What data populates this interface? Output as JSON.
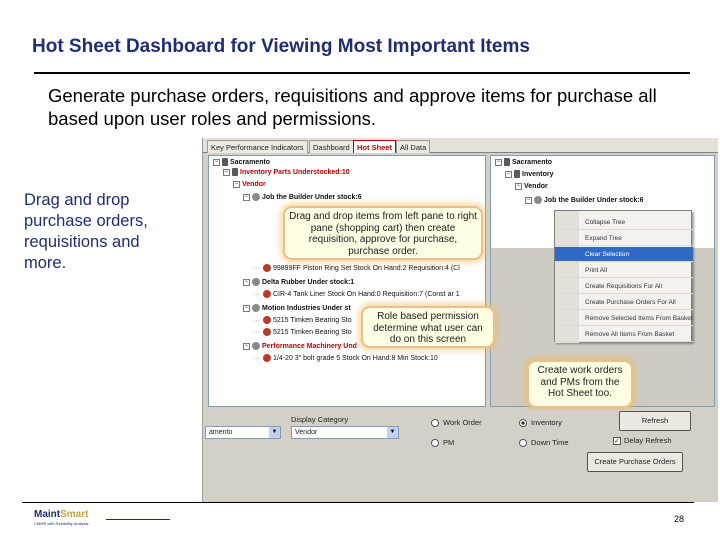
{
  "slide": {
    "title": "Hot Sheet Dashboard for Viewing Most Important Items",
    "subtitle": "Generate purchase orders, requisitions and approve items for purchase all based upon user roles and permissions.",
    "side_text": "Drag and drop purchase orders, requisitions and more.",
    "page_number": "28",
    "logo_main": "Maint",
    "logo_accent": "Smart",
    "logo_tagline": "CMMS with Reliability Analysis"
  },
  "app": {
    "tabs": [
      "Key Performance Indicators",
      "Dashboard",
      "Hot Sheet",
      "All Data"
    ],
    "active_tab": "Hot Sheet",
    "left_tree": [
      {
        "text": "Sacramento",
        "style": "bold",
        "indent": 0,
        "icon": "folder"
      },
      {
        "text": "Inventory Parts Understocked:10",
        "style": "red",
        "indent": 1,
        "icon": "folder"
      },
      {
        "text": "Vendor",
        "style": "red",
        "indent": 2,
        "icon": "none"
      },
      {
        "text": "Job the Builder Under stock:6",
        "style": "bold",
        "indent": 3,
        "icon": "cancel"
      },
      {
        "text": "99899FF Piston Ring Set Stock On Hand:2 Requisition:4 (Cl",
        "style": "normal",
        "indent": 4,
        "icon": "gear"
      },
      {
        "text": "Delta Rubber Under stock:1",
        "style": "bold",
        "indent": 3,
        "icon": "cancel"
      },
      {
        "text": "CIR-4 Tank Liner Stock On Hand:0 Requisition:7 (Const ar 1",
        "style": "normal",
        "indent": 4,
        "icon": "gear"
      },
      {
        "text": "Motion Industries Under st",
        "style": "bold",
        "indent": 3,
        "icon": "cancel"
      },
      {
        "text": "5215 Timken Bearing Sto",
        "style": "normal",
        "indent": 4,
        "icon": "gear"
      },
      {
        "text": "5215 Timken Bearing Sto",
        "style": "normal",
        "indent": 4,
        "icon": "gear"
      },
      {
        "text": "Performance Machinery Und",
        "style": "red",
        "indent": 3,
        "icon": "cancel"
      },
      {
        "text": "1/4-20 3\" bolt grade 5 Stock On Hand:8 Min Stock:10",
        "style": "normal",
        "indent": 4,
        "icon": "gear"
      }
    ],
    "right_tree": [
      {
        "text": "Sacramento",
        "style": "bold",
        "indent": 0,
        "icon": "folder"
      },
      {
        "text": "Inventory",
        "style": "bold",
        "indent": 1,
        "icon": "folder"
      },
      {
        "text": "Vendor",
        "style": "bold",
        "indent": 2,
        "icon": "none"
      },
      {
        "text": "Job the Builder Under stock:6",
        "style": "bold",
        "indent": 3,
        "icon": "cancel"
      }
    ],
    "context_menu": [
      {
        "label": "Collapse Tree",
        "selected": false
      },
      {
        "label": "Expand Tree",
        "selected": false
      },
      {
        "label": "Clear Selection",
        "selected": true
      },
      {
        "label": "Print All",
        "selected": false
      },
      {
        "label": "Create Requisitions For All",
        "selected": false
      },
      {
        "label": "Create Purchase Orders For All",
        "selected": false
      },
      {
        "label": "Remove Selected Items From Basket",
        "selected": false
      },
      {
        "label": "Remove All Items From Basket",
        "selected": false
      }
    ],
    "callouts": {
      "drag_drop": "Drag and drop items from left pane to right pane (shopping cart) then create requisition, approve for purchase, purchase order.",
      "role_based": "Role based permission determine what user can do on this screen",
      "work_orders": "Create work orders and PMs from the Hot Sheet too."
    },
    "bottom": {
      "display_category_label": "Display Category",
      "site_value": "amento",
      "category_value": "Vendor",
      "radio_work_order": "Work Order",
      "radio_inventory": "Inventory",
      "radio_pm": "PM",
      "radio_down_time": "Down Time",
      "refresh_button": "Refresh",
      "delay_refresh": "Delay Refresh",
      "create_po_button": "Create Purchase Orders"
    }
  },
  "colors": {
    "title_blue": "#1f2d73",
    "tab_active_red": "#c00000",
    "menu_highlight": "#316ac5",
    "callout_border": "#e7c38a"
  }
}
